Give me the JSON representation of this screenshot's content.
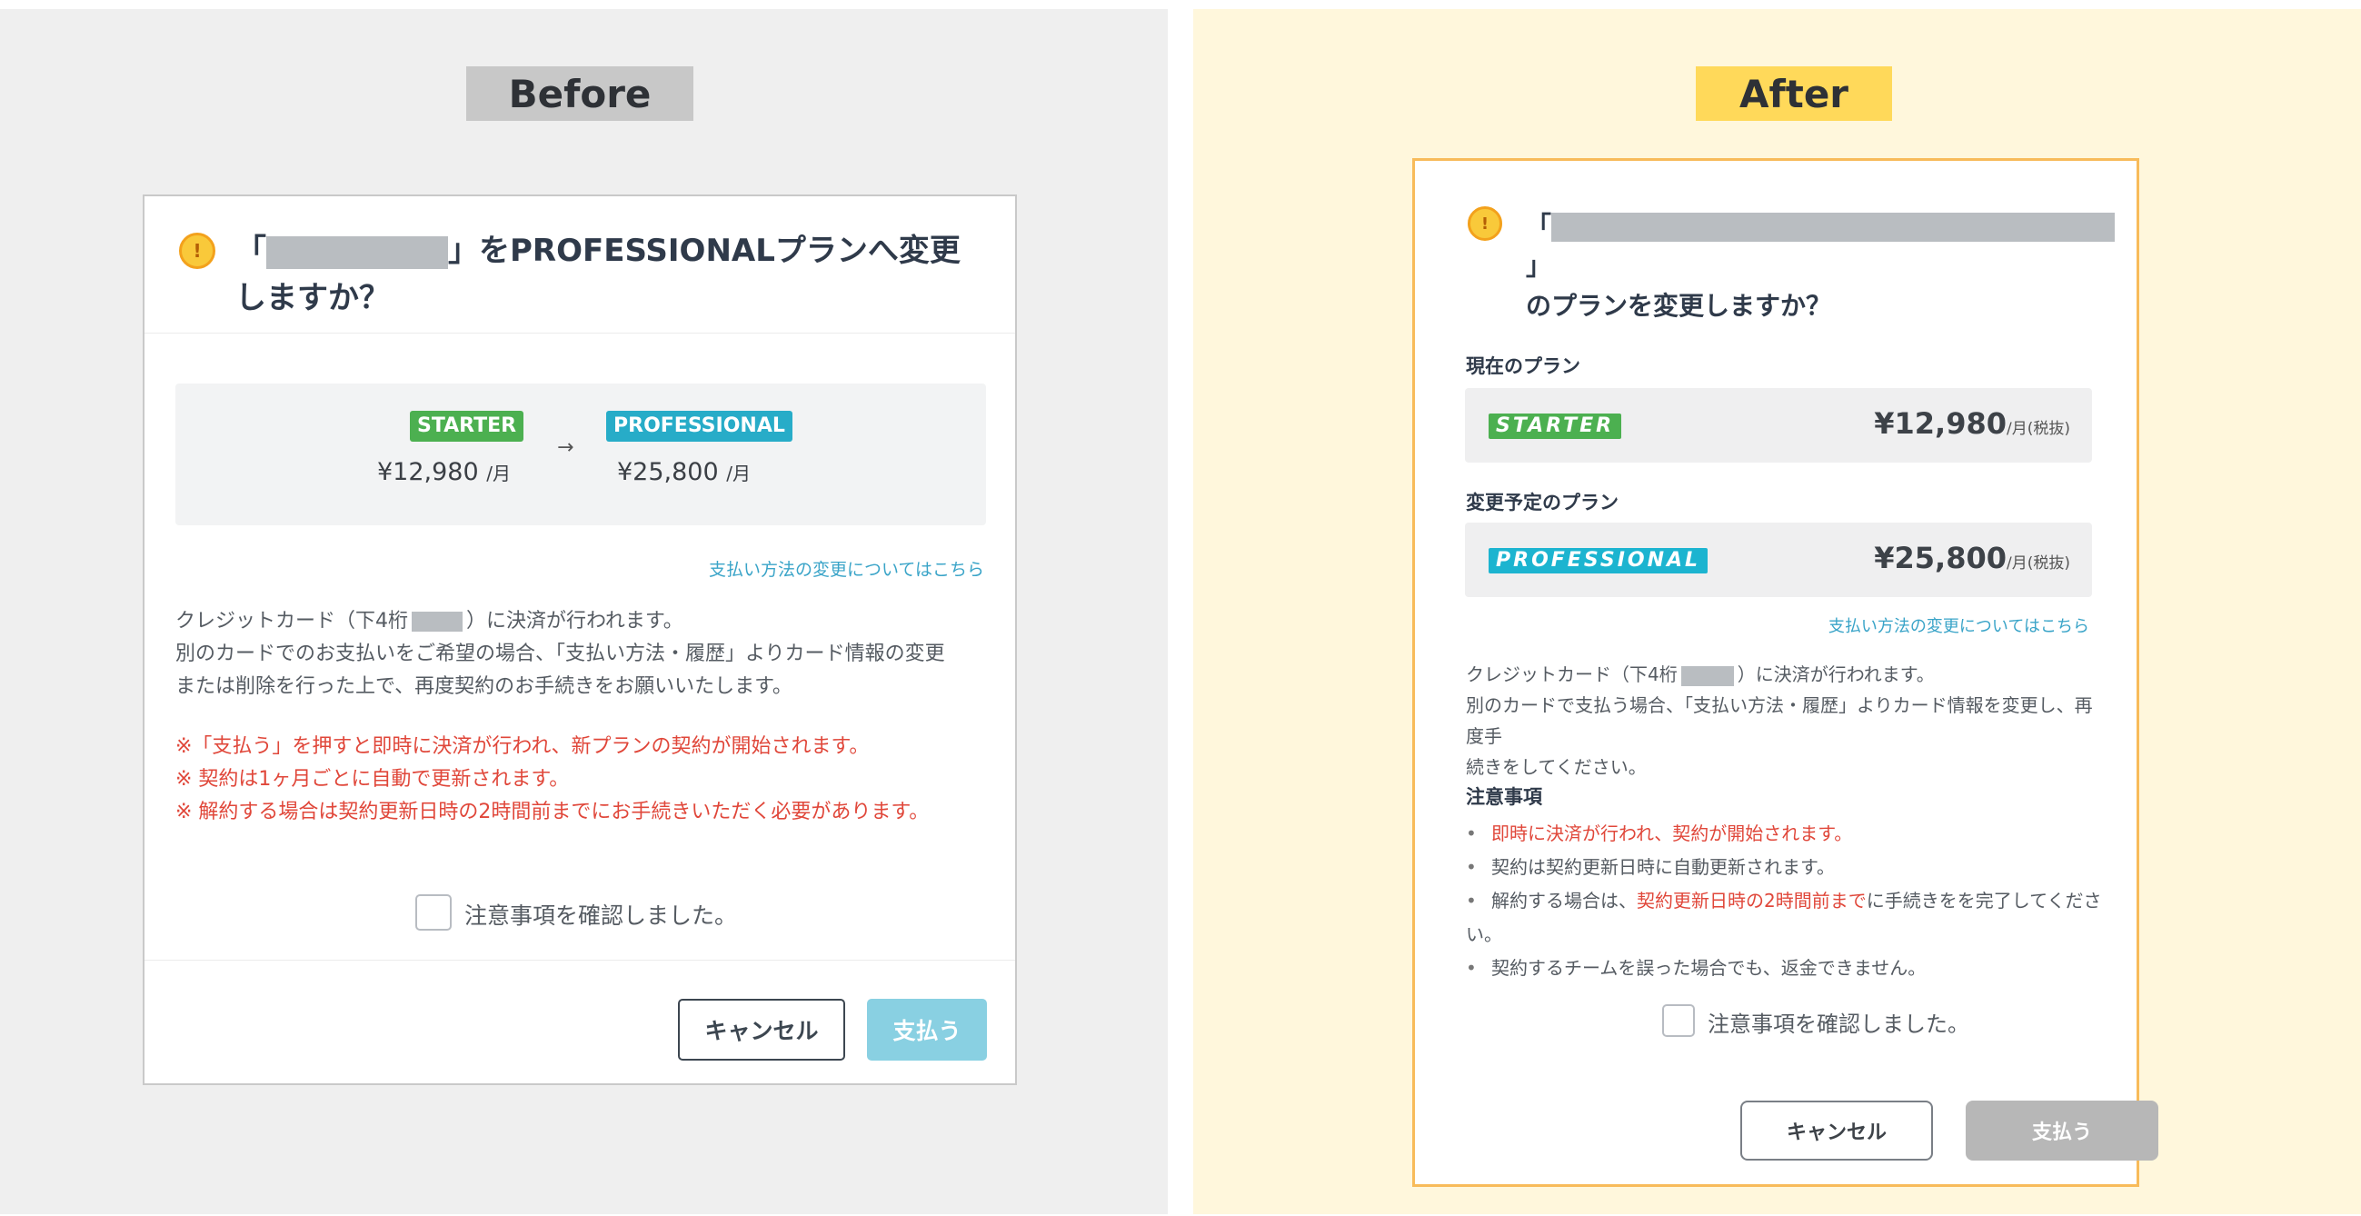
{
  "before": {
    "label": "Before",
    "title_open": "「",
    "title_rest": "」をPROFESSIONALプランへ変更しますか？",
    "plans": {
      "from_badge": "STARTER",
      "from_price": "¥12,980",
      "from_unit": "/月",
      "arrow": "→",
      "to_badge": "PROFESSIONAL",
      "to_price": "¥25,800",
      "to_unit": "/月"
    },
    "payment_link": "支払い方法の変更についてはこちら",
    "card_line_pre": "クレジットカード（下4桁",
    "card_line_post": "）に決済が行われます。",
    "body_line2": "別のカードでのお支払いをご希望の場合、「支払い方法・履歴」よりカード情報の変更",
    "body_line3": "または削除を行った上で、再度契約のお手続きをお願いいたします。",
    "notes": [
      "※「支払う」を押すと即時に決済が行われ、新プランの契約が開始されます。",
      "※ 契約は1ヶ月ごとに自動で更新されます。",
      "※ 解約する場合は契約更新日時の2時間前までにお手続きいただく必要があります。"
    ],
    "confirm_label": "注意事項を確認しました。",
    "cancel_label": "キャンセル",
    "pay_label": "支払う"
  },
  "after": {
    "label": "After",
    "title_open": "「",
    "title_close": "」",
    "title_line2": "のプランを変更しますか？",
    "current_plan_heading": "現在のプラン",
    "current_plan_badge": "STARTER",
    "current_plan_price": "¥12,980",
    "current_plan_unit": "/月(税抜)",
    "new_plan_heading": "変更予定のプラン",
    "new_plan_badge": "PROFESSIONAL",
    "new_plan_price": "¥25,800",
    "new_plan_unit": "/月(税抜)",
    "payment_link": "支払い方法の変更についてはこちら",
    "card_line_pre": "クレジットカード（下4桁",
    "card_line_post": "）に決済が行われます。",
    "body_line2": "別のカードで支払う場合、「支払い方法・履歴」よりカード情報を変更し、再度手",
    "body_line3": "続きをしてください。",
    "notes_heading": "注意事項",
    "note1": "即時に決済が行われ、契約が開始されます。",
    "note2": "契約は契約更新日時に自動更新されます。",
    "note3_pre": "解約する場合は、",
    "note3_red": "契約更新日時の2時間前まで",
    "note3_post": "に手続きをを完了してください。",
    "note4": "契約するチームを誤った場合でも、返金できません。",
    "bullet": "•",
    "confirm_label": "注意事項を確認しました。",
    "cancel_label": "キャンセル",
    "pay_label": "支払う"
  },
  "colors": {
    "before_bg": "#efefef",
    "after_bg": "#fff7dc",
    "warning_red": "#e0473a",
    "link_blue": "#3aa4c8",
    "starter_green": "#4cb050",
    "professional_blue": "#1cb4d0"
  },
  "icons": {
    "warning": "exclamation-circle-icon",
    "arrow": "arrow-right-icon"
  }
}
